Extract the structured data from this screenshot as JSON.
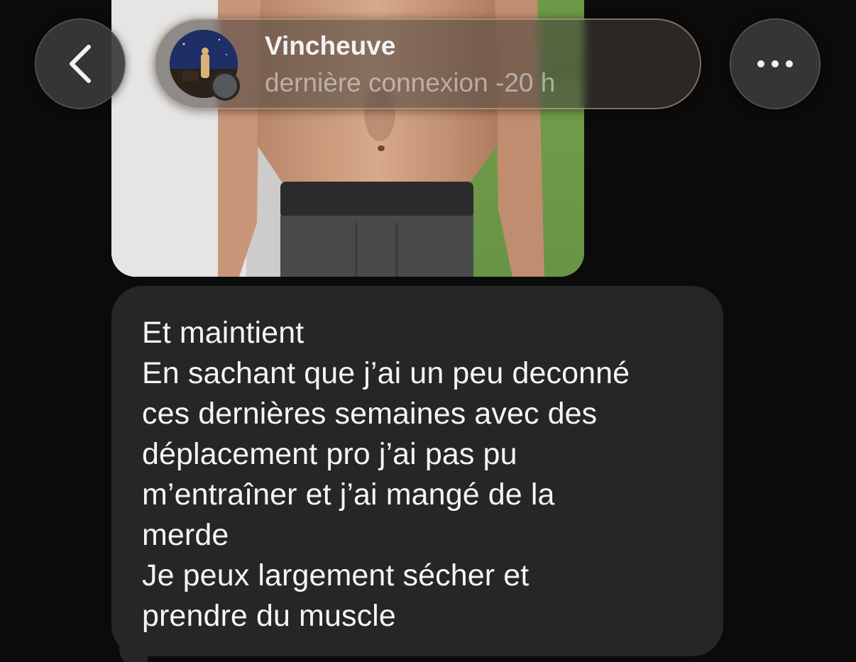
{
  "header": {
    "contact_name": "Vincheuve",
    "last_seen": "dernière connexion -20 h",
    "back_icon": "chevron-left-icon",
    "more_icon": "ellipsis-horizontal-icon"
  },
  "messages": [
    {
      "type": "image",
      "description_icon": "photo"
    },
    {
      "type": "text",
      "lines": [
        "Et maintient",
        "En sachant que j’ai un peu deconné",
        "ces dernières semaines avec des",
        "déplacement pro j’ai pas pu",
        "m’entraîner et j’ai mangé de la",
        "merde",
        "Je peux largement sécher et",
        "prendre du muscle"
      ]
    }
  ],
  "colors": {
    "background": "#0b0b0c",
    "bubble": "#262628",
    "text": "#f5f5f7"
  }
}
